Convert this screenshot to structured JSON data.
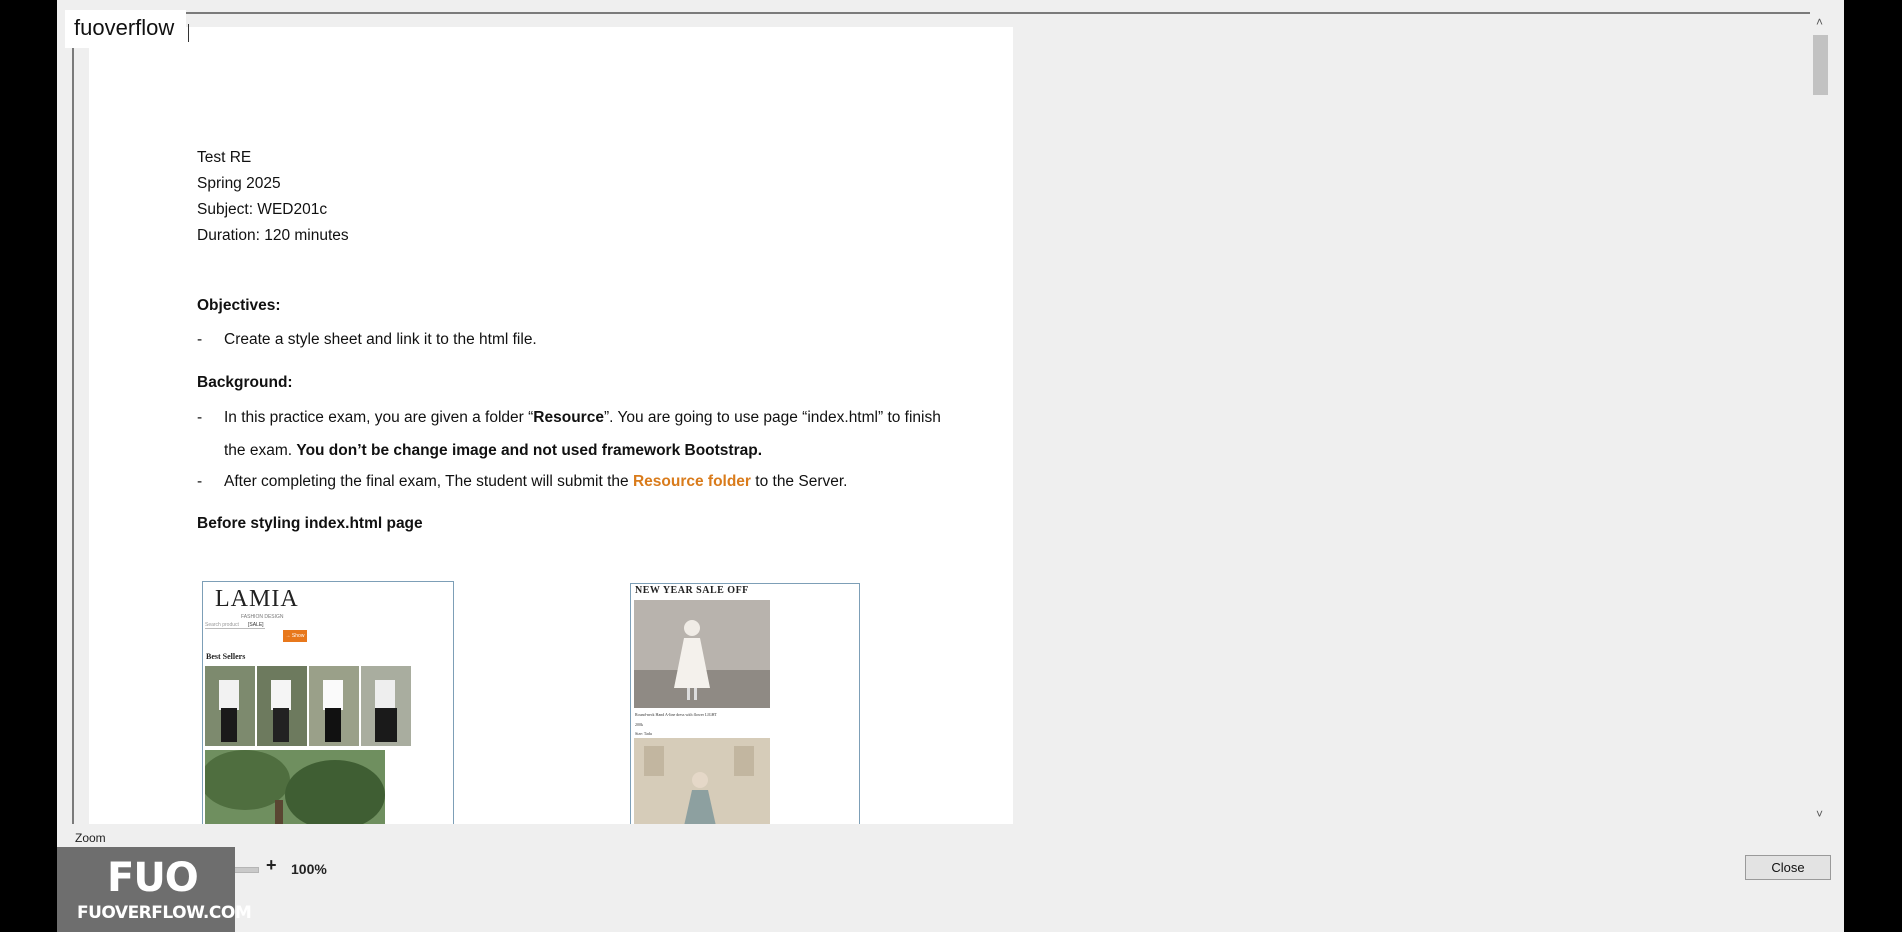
{
  "window": {
    "title": "fuoverflow"
  },
  "document": {
    "header_lines": [
      "Test RE",
      "Spring 2025",
      "Subject: WED201c",
      "Duration: 120 minutes"
    ],
    "objectives": {
      "heading": "Objectives:",
      "item1": "Create a style sheet and link it to the html file."
    },
    "background": {
      "heading": "Background:",
      "item1_part1": "In this practice exam, you are given a folder “",
      "item1_resource": "Resource",
      "item1_part2": "”. You are going to use page “index.html”  to finish the exam. ",
      "item1_bold": "You don’t be change image and not used framework Bootstrap.",
      "item2_part1": "After completing the final exam, The student will submit the ",
      "item2_orange": "Resource folder",
      "item2_part2": " to the Server."
    },
    "before_heading": "Before styling index.html page",
    "image1": {
      "logo": "LAMIA",
      "tagline": "FASHION DESIGN",
      "search_placeholder": "Search product",
      "small_text": "[SALE]",
      "button": "→ Show",
      "section_head": "Best Sellers"
    },
    "image2": {
      "title": "NEW YEAR SALE OFF",
      "caption": "Round-neck Hand A-line dress with flower LIGHT",
      "price": "200k",
      "size": "Size: Tadu"
    }
  },
  "zoom": {
    "label": "Zoom",
    "minus": "-",
    "plus": "+",
    "value": "100%"
  },
  "buttons": {
    "close": "Close"
  },
  "scrollbar": {
    "up": "˄",
    "down": "˅"
  },
  "watermark": {
    "logo": "FUO",
    "text": "FUOVERFLOW.COM"
  }
}
